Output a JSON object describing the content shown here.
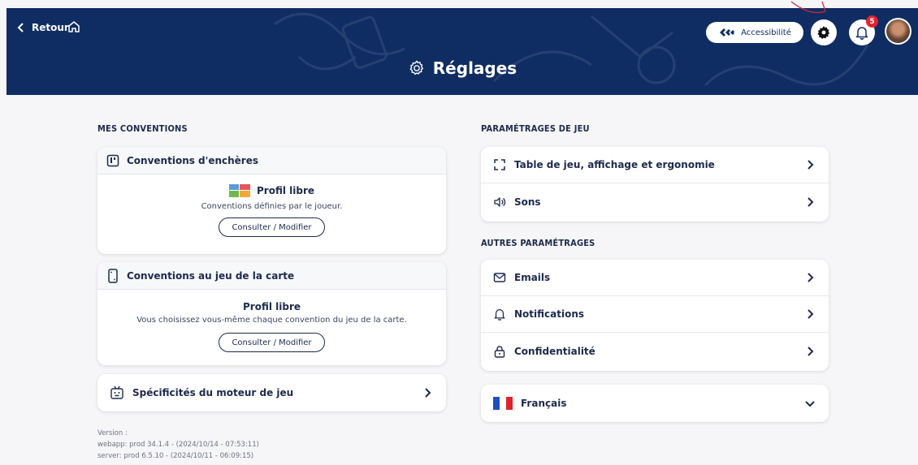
{
  "header": {
    "back_label": "Retour",
    "title": "Réglages",
    "accessibility_label": "Accessibilité",
    "notifications_count": "5"
  },
  "left": {
    "section_title": "MES CONVENTIONS",
    "bidding_card": {
      "title": "Conventions d'enchères",
      "profile": "Profil libre",
      "description": "Conventions définies par le joueur.",
      "button": "Consulter / Modifier"
    },
    "cardplay_card": {
      "title": "Conventions au jeu de la carte",
      "profile": "Profil libre",
      "description": "Vous choisissez vous-même chaque convention du jeu de la carte.",
      "button": "Consulter / Modifier"
    },
    "engine_row": "Spécificités du moteur de jeu"
  },
  "right": {
    "game_section_title": "PARAMÉTRAGES DE JEU",
    "game_rows": [
      "Table de jeu, affichage et ergonomie",
      "Sons"
    ],
    "other_section_title": "AUTRES PARAMÉTRAGES",
    "other_rows": [
      "Emails",
      "Notifications",
      "Confidentialité"
    ],
    "language": "Français"
  },
  "version": {
    "label": "Version :",
    "webapp": "webapp: prod 34.1.4 - (2024/10/14 - 07:53:11)",
    "server": "server: prod 6.5.10 - (2024/10/11 - 06:09:15)"
  },
  "colors": {
    "header_bg": "#0f2d63",
    "badge": "#e32332",
    "text": "#1d2a4d",
    "annotation": "#d9262b"
  }
}
